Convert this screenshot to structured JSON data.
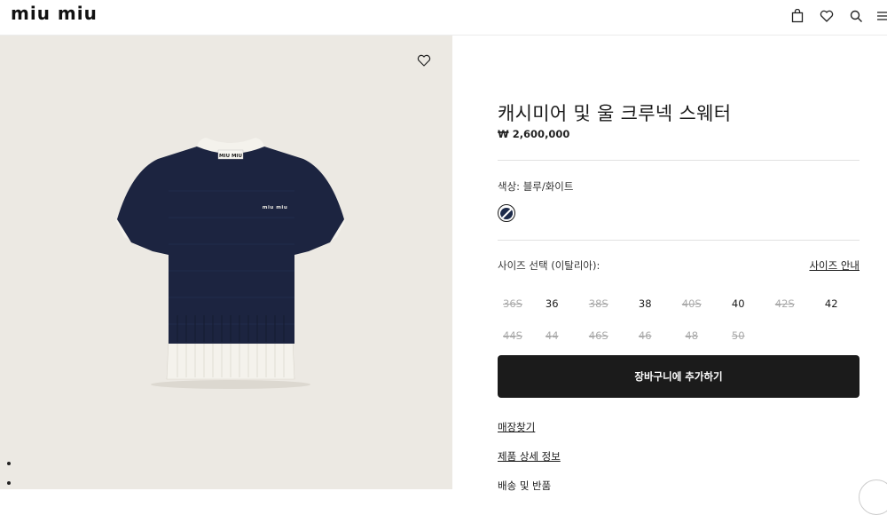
{
  "header": {
    "logo": "miu miu",
    "icons": [
      "bag-icon",
      "heart-icon",
      "search-icon",
      "menu-icon"
    ]
  },
  "gallery": {
    "wishlist_icon": "heart-icon",
    "slide_count": 2
  },
  "product": {
    "title": "캐시미어 및 울 크루넥 스웨터",
    "price": "₩ 2,600,000",
    "color_label": "색상: 블루/화이트",
    "swatch_colors": {
      "primary": "#1c2a4a",
      "secondary": "#ffffff"
    },
    "size_label": "사이즈 선택 (이탈리아):",
    "size_guide": "사이즈 안내",
    "sizes_row1": [
      {
        "label": "36S",
        "available": false
      },
      {
        "label": "36",
        "available": true
      },
      {
        "label": "38S",
        "available": false
      },
      {
        "label": "38",
        "available": true
      },
      {
        "label": "40S",
        "available": false
      },
      {
        "label": "40",
        "available": true
      },
      {
        "label": "42S",
        "available": false
      },
      {
        "label": "42",
        "available": true
      }
    ],
    "sizes_row2": [
      {
        "label": "44S",
        "available": false
      },
      {
        "label": "44",
        "available": false
      },
      {
        "label": "46S",
        "available": false
      },
      {
        "label": "46",
        "available": false
      },
      {
        "label": "48",
        "available": false
      },
      {
        "label": "50",
        "available": false
      }
    ],
    "add_to_cart": "장바구니에 추가하기",
    "links": {
      "find_store": "매장찾기",
      "details": "제품 상세 정보",
      "shipping": "배송 및 반품"
    }
  },
  "colors": {
    "sweater_navy": "#1c2440",
    "trim_white": "#f4f2ec",
    "background": "#ece9e3",
    "button": "#1b1b1b"
  }
}
